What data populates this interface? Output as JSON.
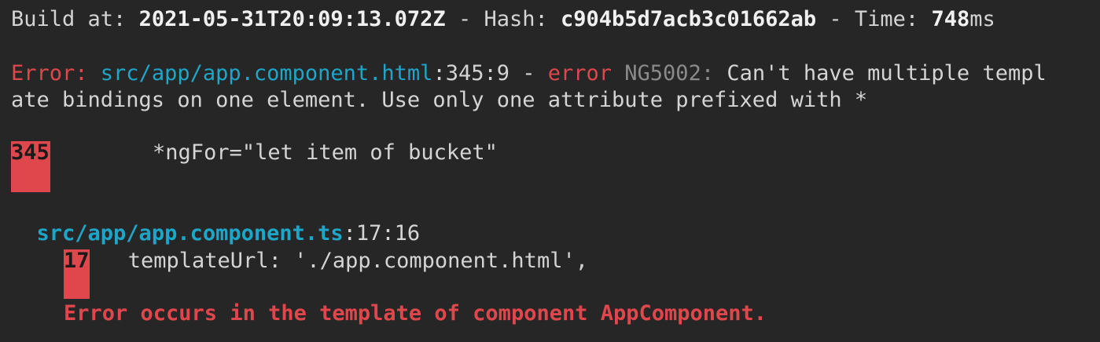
{
  "build": {
    "label": "Build at: ",
    "timestamp": "2021-05-31T20:09:13.072Z",
    "sep1": " - Hash: ",
    "hash": "c904b5d7acb3c01662ab",
    "sep2": " - Time: ",
    "time_value": "748",
    "time_unit": "ms"
  },
  "error": {
    "prefix": "Error: ",
    "file": "src/app/app.component.html",
    "location": ":345:9 - ",
    "word": "error",
    "code": " NG5002:",
    "message_part1": " Can't have multiple templ",
    "message_part2": "ate bindings on one element. Use only one attribute prefixed with *"
  },
  "snippet1": {
    "line_number": "345",
    "code": "        *ngFor=\"let item of bucket\""
  },
  "reference": {
    "file": "src/app/app.component.ts",
    "location": ":17:16"
  },
  "snippet2": {
    "line_number": "17",
    "code": "   templateUrl: './app.component.html',"
  },
  "footer": {
    "message": "Error occurs in the template of component AppComponent."
  },
  "colors": {
    "background": "#262626",
    "error_red": "#e0474c",
    "path_cyan": "#1ea6c9",
    "code_gray": "#8a8a8a"
  }
}
